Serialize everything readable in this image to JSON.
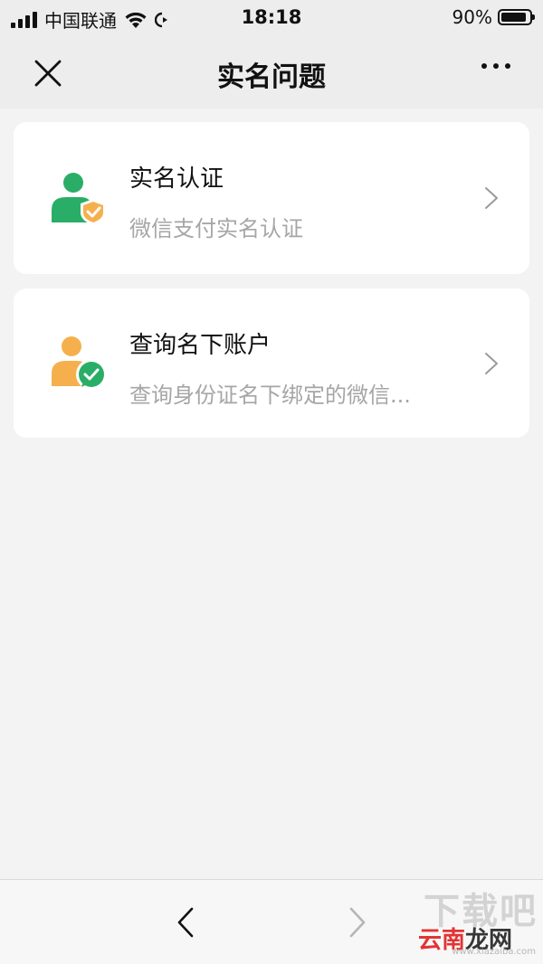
{
  "status_bar": {
    "carrier": "中国联通",
    "time": "18:18",
    "battery_percent": "90%",
    "battery_level": 0.9
  },
  "nav": {
    "title": "实名问题",
    "close_icon": "close-icon",
    "more_icon": "more-icon"
  },
  "cards": [
    {
      "title": "实名认证",
      "subtitle": "微信支付实名认证",
      "icon": "user-shield-icon"
    },
    {
      "title": "查询名下账户",
      "subtitle": "查询身份证名下绑定的微信...",
      "icon": "user-wechat-icon"
    }
  ],
  "toolbar": {
    "back_icon": "chevron-left-icon",
    "forward_icon": "chevron-right-icon"
  },
  "watermark": {
    "top": "下载吧",
    "mid_red": "云南",
    "mid_black": "龙网",
    "url": "www.xiazaiba.com"
  },
  "colors": {
    "green": "#2aae67",
    "orange": "#f5b04d",
    "background": "#f3f3f3",
    "card": "#ffffff",
    "subtext": "#a6a6a6"
  }
}
